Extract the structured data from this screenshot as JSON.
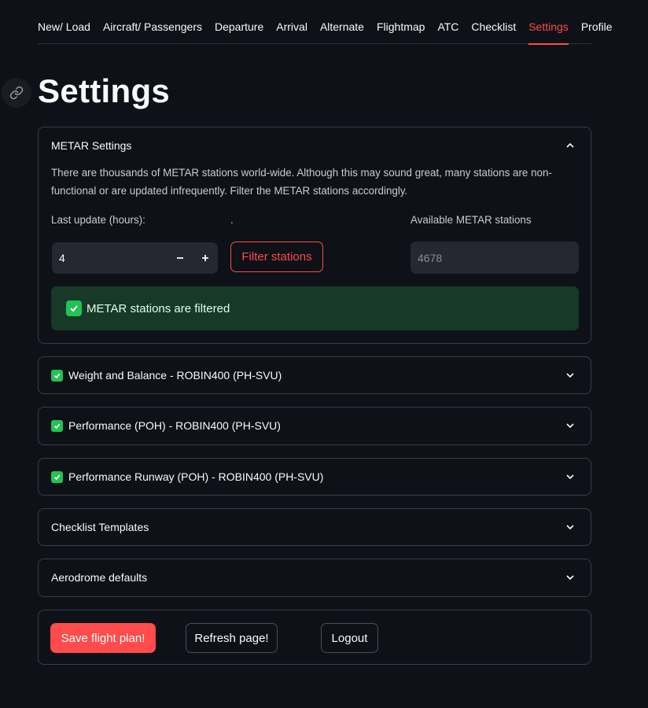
{
  "tabs": [
    {
      "label": "New/ Load"
    },
    {
      "label": "Aircraft/ Passengers"
    },
    {
      "label": "Departure"
    },
    {
      "label": "Arrival"
    },
    {
      "label": "Alternate"
    },
    {
      "label": "Flightmap"
    },
    {
      "label": "ATC"
    },
    {
      "label": "Checklist"
    },
    {
      "label": "Settings",
      "active": true
    },
    {
      "label": "Profile"
    }
  ],
  "title": "Settings",
  "metar": {
    "header": "METAR Settings",
    "description": "There are thousands of METAR stations world-wide. Although this may sound great, many stations are non-functional or are updated infrequently. Filter the METAR stations accordingly.",
    "last_update_label": "Last update (hours):",
    "last_update_value": "4",
    "dot_label": ".",
    "filter_button": "Filter stations",
    "available_label": "Available METAR stations",
    "available_value": "4678",
    "success_message": "METAR stations are filtered"
  },
  "expanders": [
    {
      "label": "Weight and Balance - ROBIN400 (PH-SVU)",
      "checked": true
    },
    {
      "label": "Performance (POH) - ROBIN400 (PH-SVU)",
      "checked": true
    },
    {
      "label": "Performance Runway (POH) - ROBIN400 (PH-SVU)",
      "checked": true
    },
    {
      "label": "Checklist Templates",
      "checked": false
    },
    {
      "label": "Aerodrome defaults",
      "checked": false
    }
  ],
  "buttons": {
    "save": "Save flight plan!",
    "refresh": "Refresh page!",
    "logout": "Logout"
  },
  "colors": {
    "background": "#0e1117",
    "accent": "#ff4b4b",
    "success_bg": "#173928",
    "check": "#21c354"
  }
}
